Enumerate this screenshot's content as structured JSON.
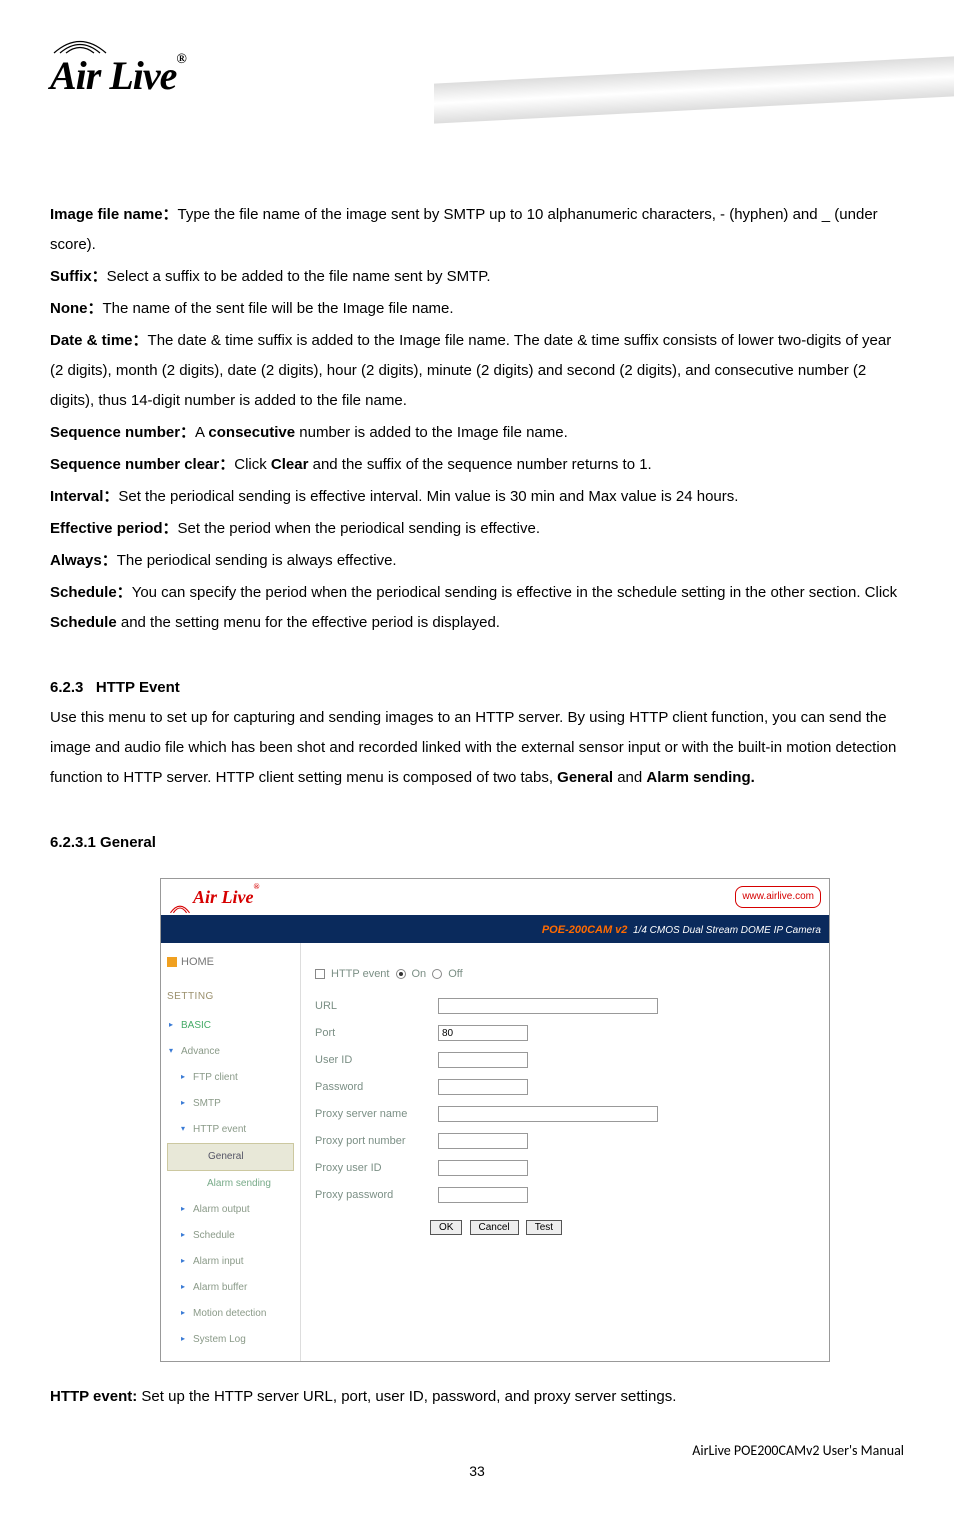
{
  "brand": "Air Live",
  "defs": [
    {
      "label": "Image file name：",
      "text": "Type the file name of the image sent by SMTP up to 10 alphanumeric characters, - (hyphen) and _ (under score)."
    },
    {
      "label": "Suffix：",
      "text": "Select a suffix to be added to the file name sent by SMTP."
    },
    {
      "label": "None：",
      "text": "The name of the sent file will be the Image file name."
    },
    {
      "label": "Date & time：",
      "text": "The date & time suffix is added to the Image file name. The date & time suffix consists of lower two-digits of year (2 digits), month (2 digits), date (2 digits), hour (2 digits), minute (2 digits) and second (2 digits), and consecutive number (2 digits), thus 14-digit number is added to the file name."
    },
    {
      "label": "Sequence number：",
      "text_prefix": "A ",
      "bold": "consecutive",
      "text_suffix": " number is added to the Image file name."
    },
    {
      "label": "Sequence number clear：",
      "text_prefix": "Click ",
      "bold": "Clear",
      "text_suffix": " and the suffix of the sequence number returns to 1."
    },
    {
      "label": "Interval：",
      "text": "Set the periodical sending is effective interval. Min value is 30 min and Max value is 24 hours."
    },
    {
      "label": "Effective period：",
      "text": "Set the period when the periodical sending is effective."
    },
    {
      "label": "Always：",
      "text": "The periodical sending is always effective."
    },
    {
      "label": "Schedule：",
      "text_prefix": "You can specify the period when the periodical sending is effective in the schedule setting in the other section. Click ",
      "bold": "Schedule",
      "text_suffix": " and the setting menu for the effective period is displayed."
    }
  ],
  "section_num": "6.2.3",
  "section_title": "HTTP Event",
  "section_intro_pre": "Use this menu to set up for capturing and sending images to an HTTP server. By using HTTP client function, you can send the image and audio file which has been shot and recorded linked with the external sensor input or with the built-in motion detection function to HTTP server. HTTP client setting menu is composed of two tabs, ",
  "section_intro_b1": "General",
  "section_intro_mid": " and ",
  "section_intro_b2": "Alarm sending.",
  "subsection": "6.2.3.1 General",
  "shot": {
    "logo": "Air Live",
    "site": "www.airlive.com",
    "prod": "POE-200CAM v2",
    "prod_desc": "1/4 CMOS Dual Stream DOME IP Camera",
    "home": "HOME",
    "setting": "SETTING",
    "nav": {
      "basic": "BASIC",
      "advance": "Advance",
      "ftp": "FTP client",
      "smtp": "SMTP",
      "http": "HTTP event",
      "general": "General",
      "alarmsend": "Alarm sending",
      "alarmout": "Alarm output",
      "schedule": "Schedule",
      "alarmin": "Alarm input",
      "alarmbuf": "Alarm buffer",
      "motion": "Motion detection",
      "syslog": "System Log"
    },
    "topline": {
      "cb": "HTTP event",
      "on": "On",
      "off": "Off"
    },
    "fields": {
      "url": "URL",
      "port": "Port",
      "port_val": "80",
      "user": "User ID",
      "pass": "Password",
      "proxy": "Proxy server name",
      "proxyport": "Proxy port number",
      "proxyuser": "Proxy user ID",
      "proxypass": "Proxy password"
    },
    "buttons": {
      "ok": "OK",
      "cancel": "Cancel",
      "test": "Test"
    }
  },
  "bottom_label": "HTTP event:",
  "bottom_text": " Set up the HTTP server URL, port, user ID, password, and proxy server settings.",
  "footer_right": "AirLive POE200CAMv2 User's Manual",
  "page_no": "33"
}
